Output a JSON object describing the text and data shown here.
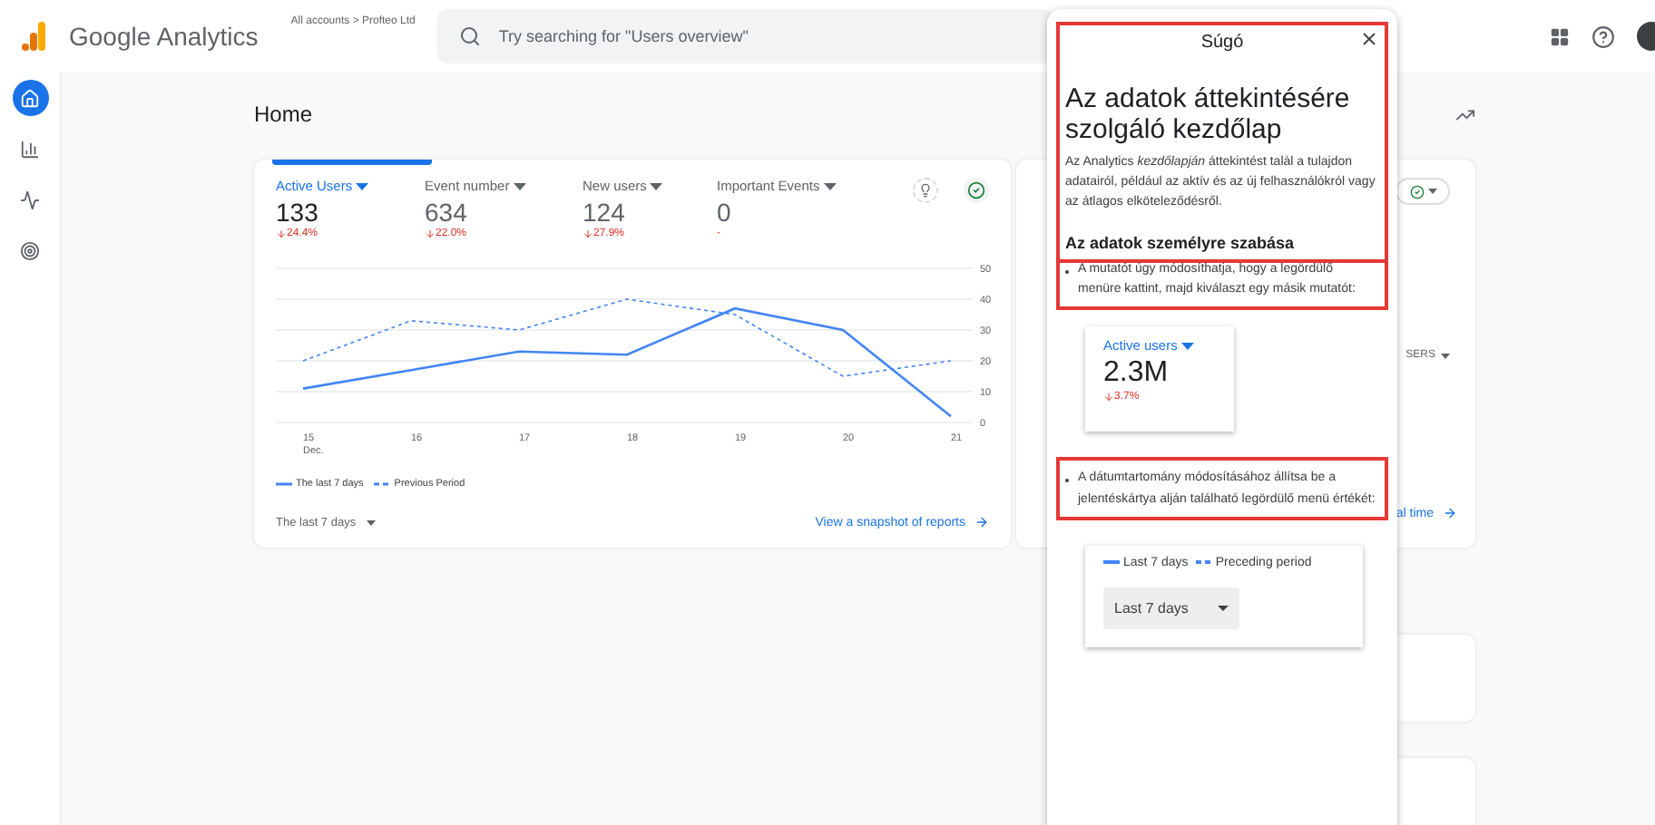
{
  "header": {
    "product": "Google Analytics",
    "breadcrumb": "All accounts > Profteo Ltd",
    "search": {
      "placeholder": "Try searching for \"Users overview\""
    }
  },
  "rail": [
    {
      "kind": "home",
      "selected": true
    },
    {
      "kind": "reports",
      "selected": false
    },
    {
      "kind": "explore",
      "selected": false
    },
    {
      "kind": "advertising",
      "selected": false
    }
  ],
  "page_title": "Home",
  "metrics": [
    {
      "label": "Active Users",
      "value": "133",
      "change": "24.4%",
      "selected": true
    },
    {
      "label": "Event number",
      "value": "634",
      "change": "22.0%",
      "selected": false
    },
    {
      "label": "New users",
      "value": "124",
      "change": "27.9%",
      "selected": false
    },
    {
      "label": "Important Events",
      "value": "0",
      "change": "-",
      "selected": false
    }
  ],
  "chart_data": {
    "type": "line",
    "categories": [
      "15",
      "16",
      "17",
      "18",
      "19",
      "20",
      "21"
    ],
    "ylim": [
      0,
      50
    ],
    "yticks": [
      0,
      10,
      20,
      30,
      40,
      50
    ],
    "grid": true,
    "series": [
      {
        "name": "The last 7 days",
        "color": "#4285f4",
        "line_style": "solid",
        "values": [
          11,
          17,
          23,
          22,
          37,
          30,
          2
        ]
      },
      {
        "name": "Previous Period",
        "color": "#4285f4",
        "line_style": "dashed",
        "values": [
          20,
          33,
          30,
          40,
          35,
          15,
          20
        ]
      }
    ]
  },
  "chart_month": "Dec.",
  "date_range": "The last 7 days",
  "report_link": "View a snapshot of reports",
  "card2": {
    "column_text": "SERS",
    "link": "al time"
  },
  "help": {
    "title": "Súgó",
    "heading": "Az adatok áttekintésére szolgáló kezdőlap",
    "intro": "Az Analytics *kezdőlapján* áttekintést talál a tulajdon adatairól, például az aktív és az új felhasználókról vagy az átlagos elköteleződésről.",
    "subheading": "Az adatok személyre szabása",
    "bullets": [
      {
        "text": "A mutatót úgy módosíthatja, hogy a legördülő menüre kattint, majd kiválaszt egy másik mutatót:",
        "highlighted": true
      },
      {
        "text": "A dátumtartomány módosításához állítsa be a jelentéskártya alján található legördülő menü értékét:",
        "highlighted": true
      }
    ],
    "intro_highlighted": true,
    "example_metric": {
      "label": "Active users",
      "value": "2.3M",
      "change": "3.7%"
    },
    "example_legend": [
      "Last 7 days",
      "Preceding period"
    ],
    "example_dropdown": "Last 7 days"
  }
}
